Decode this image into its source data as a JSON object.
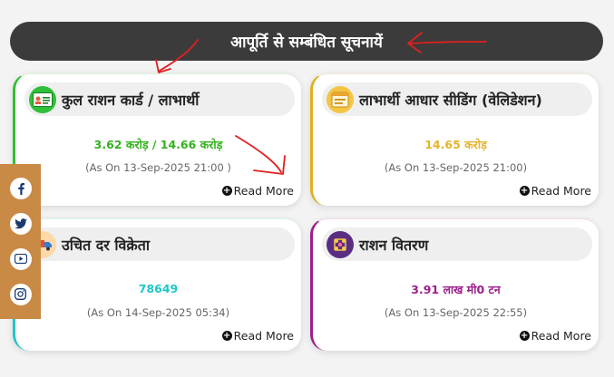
{
  "header": {
    "title": "आपूर्ति से सम्बंधित सूचनायें"
  },
  "cards": [
    {
      "title": "कुल राशन कार्ड / लाभार्थी",
      "value": "3.62 करोड़ / 14.66 करोड़",
      "asof": "(As On 13-Sep-2025 21:00 )",
      "readmore": "Read More",
      "value_color": "#33b21e",
      "icon": "ration-card-icon"
    },
    {
      "title": "लाभार्थी आधार सीडिंग (वेलिडेशन)",
      "value": "14.65 करोड़",
      "asof": "(As On 13-Sep-2025 21:00)",
      "readmore": "Read More",
      "value_color": "#e5b32c",
      "icon": "aadhaar-seeding-icon"
    },
    {
      "title": "उचित दर विक्रेता",
      "value": "78649",
      "asof": "(As On 14-Sep-2025 05:34)",
      "readmore": "Read More",
      "value_color": "#1ec6c6",
      "icon": "delivery-truck-icon"
    },
    {
      "title": "राशन वितरण",
      "value": "3.91 लाख मी0 टन",
      "asof": "(As On 13-Sep-2025 22:55)",
      "readmore": "Read More",
      "value_color": "#9c1f8c",
      "icon": "distribution-icon"
    }
  ],
  "social": [
    "facebook-icon",
    "twitter-icon",
    "youtube-icon",
    "instagram-icon"
  ]
}
